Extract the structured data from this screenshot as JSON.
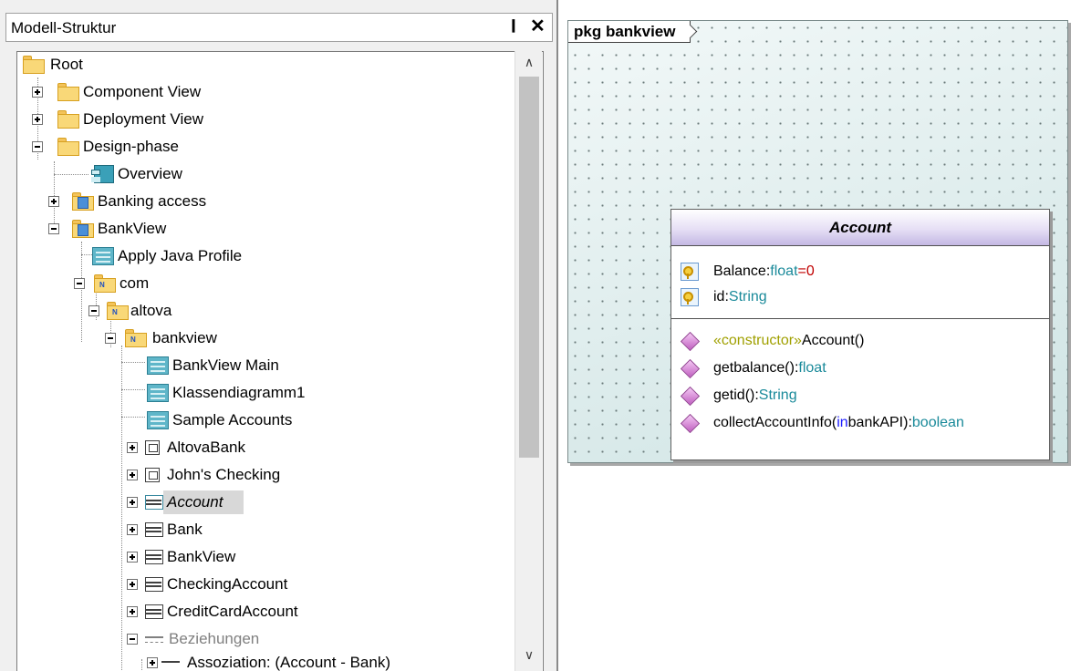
{
  "panel": {
    "title": "Modell-Struktur",
    "pin_glyph": "❙",
    "close_glyph": "✕"
  },
  "scrollbar": {
    "up_glyph": "∧",
    "down_glyph": "∨"
  },
  "tree": {
    "items": [
      {
        "label": "Root",
        "icon": "folder-icon"
      },
      {
        "label": "Component View",
        "icon": "folder-icon"
      },
      {
        "label": "Deployment View",
        "icon": "folder-icon"
      },
      {
        "label": "Design-phase",
        "icon": "folder-icon"
      },
      {
        "label": "Overview",
        "icon": "component-diagram-icon"
      },
      {
        "label": "Banking access",
        "icon": "package-icon"
      },
      {
        "label": "BankView",
        "icon": "package-icon"
      },
      {
        "label": "Apply Java Profile",
        "icon": "diagram-icon"
      },
      {
        "label": "com",
        "icon": "namespace-folder-icon"
      },
      {
        "label": "altova",
        "icon": "namespace-folder-icon"
      },
      {
        "label": "bankview",
        "icon": "namespace-folder-icon"
      },
      {
        "label": "BankView Main",
        "icon": "diagram-icon"
      },
      {
        "label": "Klassendiagramm1",
        "icon": "diagram-icon"
      },
      {
        "label": "Sample Accounts",
        "icon": "object-diagram-icon"
      },
      {
        "label": "AltovaBank",
        "icon": "object-icon"
      },
      {
        "label": "John's Checking",
        "icon": "object-icon"
      },
      {
        "label": "Account",
        "icon": "class-icon",
        "selected": true
      },
      {
        "label": "Bank",
        "icon": "class-icon"
      },
      {
        "label": "BankView",
        "icon": "class-icon"
      },
      {
        "label": "CheckingAccount",
        "icon": "class-icon"
      },
      {
        "label": "CreditCardAccount",
        "icon": "class-icon"
      },
      {
        "label": "Beziehungen",
        "icon": "relations-icon"
      },
      {
        "label": "Assoziation:  (Account - Bank)",
        "icon": "association-icon"
      }
    ]
  },
  "diagram": {
    "package_tab": "pkg bankview",
    "class_name": "Account",
    "attributes": [
      {
        "name": "Balance",
        "sep": ":",
        "type": "float",
        "default": "=0",
        "icon": "key-attribute-icon"
      },
      {
        "name": "id",
        "sep": ":",
        "type": "String",
        "default": "",
        "icon": "key-attribute-icon"
      }
    ],
    "operations": [
      {
        "stereotype": "«constructor»",
        "name": " Account()",
        "params_kw": "",
        "params_rest": "",
        "ret_sep": "",
        "ret_type": "",
        "icon": "operation-icon"
      },
      {
        "stereotype": "",
        "name": "getbalance():",
        "params_kw": "",
        "params_rest": "",
        "ret_sep": "",
        "ret_type": "float",
        "icon": "operation-icon"
      },
      {
        "stereotype": "",
        "name": "getid():",
        "params_kw": "",
        "params_rest": "",
        "ret_sep": "",
        "ret_type": "String",
        "icon": "operation-icon"
      },
      {
        "stereotype": "",
        "name": "collectAccountInfo(",
        "params_kw": "in",
        "params_rest": " bankAPI):",
        "ret_sep": "",
        "ret_type": "boolean",
        "icon": "operation-icon"
      }
    ]
  },
  "colors": {
    "type_color": "#1a8a9a",
    "default_color": "#c00000",
    "stereotype_color": "#a0a000",
    "keyword_color": "#1a1aff",
    "class_header_gradient_end": "#c4b8e4",
    "diagram_background": "#e2f0f0"
  }
}
